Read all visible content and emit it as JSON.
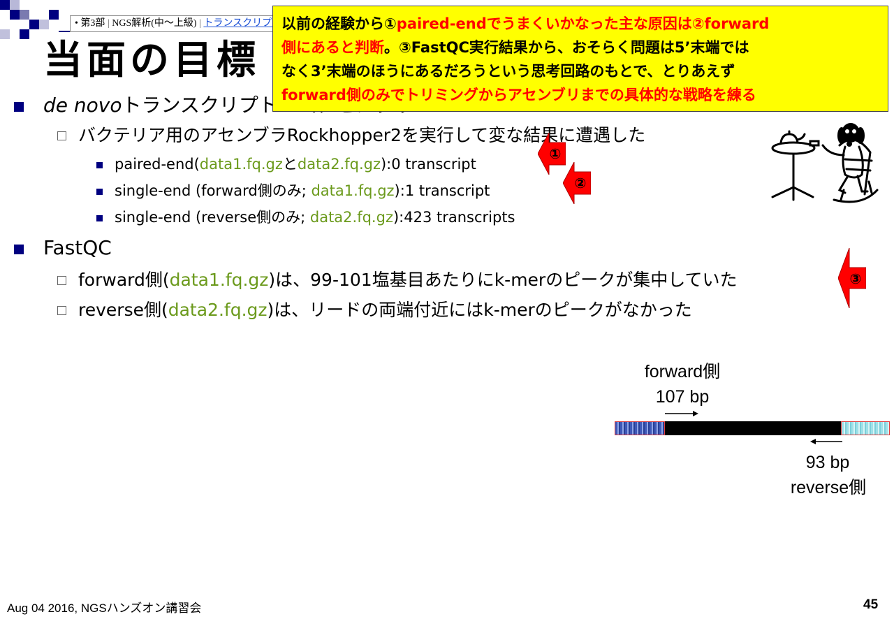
{
  "header": {
    "breadcrumb_bullet": "•",
    "breadcrumb_part": "第3部",
    "breadcrumb_sep1": "|",
    "breadcrumb_section": "NGS解析(中～上級)",
    "breadcrumb_sep2": "|",
    "breadcrumb_link": "トランスクリプトーム解析"
  },
  "slide": {
    "title": "当面の目標",
    "callout": {
      "line1_black": "以前の経験から①",
      "line1_red": "paired-endでうまくいかなった主な原因は②forward",
      "line2_red": "側にあると判断",
      "line2_black": "。③FastQC実行結果から、おそらく問題は5’末端では",
      "line3_black": "なく3’末端のほうにあるだろうという思考回路のもとで、とりあえず",
      "line4_red": "forward側のみでトリミングからアセンブリまでの具体的な戦略を練る"
    },
    "bullets": {
      "denovo_italic": "de novo",
      "denovo_rest": "トランスクリプトームアセンブリ",
      "rockhopper": "バクテリア用のアセンブラRockhopper2を実行して変な結果に遭遇した",
      "pe_a": "paired-end(",
      "pe_file1": "data1.fq.gz",
      "pe_and": "と",
      "pe_file2": "data2.fq.gz",
      "pe_b": "):0 transcript",
      "se_fwd_a": "single-end (forward側のみ; ",
      "se_fwd_file": "data1.fq.gz",
      "se_fwd_b": "):1 transcript",
      "se_rev_a": "single-end (reverse側のみ; ",
      "se_rev_file": "data2.fq.gz",
      "se_rev_b": "):423 transcripts",
      "fastqc": "FastQC",
      "fwd_a": "forward側(",
      "fwd_file": "data1.fq.gz",
      "fwd_b": ")は、99-101塩基目あたりにk-merのピークが集中していた",
      "rev_a": "reverse側(",
      "rev_file": "data2.fq.gz",
      "rev_b": ")は、リードの両端付近にはk-merのピークがなかった"
    },
    "arrows": [
      "①",
      "②",
      "③"
    ],
    "diagram": {
      "forward_label": "forward側",
      "forward_len": "107 bp",
      "reverse_len": "93 bp",
      "reverse_label": "reverse側"
    }
  },
  "footer": {
    "left": "Aug 04 2016, NGSハンズオン講習会",
    "page_number": "45"
  },
  "colors": {
    "navy": "#000080",
    "accent_red": "#ff0000",
    "callout_bg": "#ffff00",
    "file_green": "#6b9a1c"
  }
}
